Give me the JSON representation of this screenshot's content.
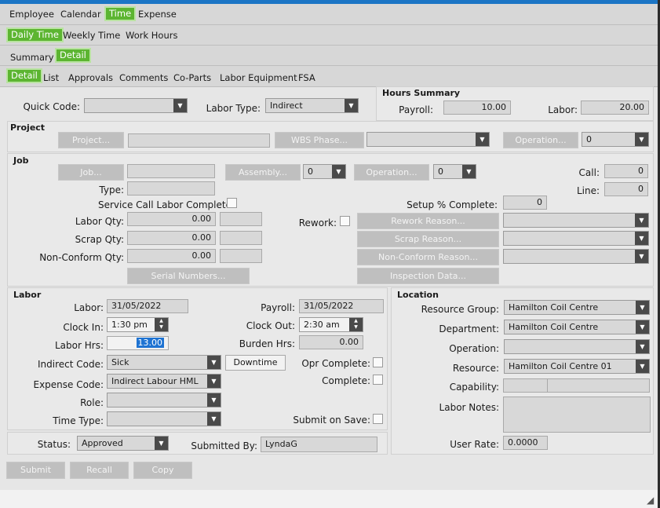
{
  "tabs1": [
    "Employee",
    "Calendar",
    "Time",
    "Expense"
  ],
  "tabs2": [
    "Daily Time",
    "Weekly Time",
    "Work Hours"
  ],
  "tabs3": [
    "Summary",
    "Detail"
  ],
  "tabs4": [
    "Detail",
    "List",
    "Approvals",
    "Comments",
    "Co-Parts",
    "Labor Equipment",
    "FSA"
  ],
  "header": {
    "quick_code_label": "Quick Code:",
    "quick_code": "",
    "labor_type_label": "Labor Type:",
    "labor_type": "Indirect"
  },
  "hours_summary": {
    "title": "Hours Summary",
    "payroll_label": "Payroll:",
    "payroll": "10.00",
    "labor_label": "Labor:",
    "labor": "20.00"
  },
  "project": {
    "title": "Project",
    "project_btn": "Project...",
    "wbs_btn": "WBS Phase...",
    "operation_btn": "Operation...",
    "operation_value": "0"
  },
  "job": {
    "title": "Job",
    "job_btn": "Job...",
    "assembly_btn": "Assembly...",
    "assembly_value": "0",
    "operation_btn": "Operation...",
    "operation_value": "0",
    "call_label": "Call:",
    "call": "0",
    "line_label": "Line:",
    "line": "0",
    "type_label": "Type:",
    "service_call_label": "Service Call Labor Complete",
    "setup_label": "Setup % Complete:",
    "setup": "0",
    "labor_qty_label": "Labor Qty:",
    "labor_qty": "0.00",
    "scrap_qty_label": "Scrap Qty:",
    "scrap_qty": "0.00",
    "nonconform_qty_label": "Non-Conform Qty:",
    "nonconform_qty": "0.00",
    "rework_label": "Rework:",
    "rework_reason_btn": "Rework Reason...",
    "scrap_reason_btn": "Scrap Reason...",
    "nonconform_reason_btn": "Non-Conform Reason...",
    "serial_btn": "Serial Numbers...",
    "inspection_btn": "Inspection Data..."
  },
  "labor": {
    "title": "Labor",
    "labor_label": "Labor:",
    "labor_date": "31/05/2022",
    "payroll_label": "Payroll:",
    "payroll_date": "31/05/2022",
    "clock_in_label": "Clock In:",
    "clock_in": "1:30 pm",
    "clock_out_label": "Clock Out:",
    "clock_out": "2:30 am",
    "labor_hrs_label": "Labor Hrs:",
    "labor_hrs": "13.00",
    "burden_hrs_label": "Burden Hrs:",
    "burden_hrs": "0.00",
    "indirect_code_label": "Indirect Code:",
    "indirect_code": "Sick",
    "downtime_btn": "Downtime",
    "opr_complete_label": "Opr Complete:",
    "complete_label": "Complete:",
    "expense_code_label": "Expense Code:",
    "expense_code": "Indirect Labour HML",
    "role_label": "Role:",
    "time_type_label": "Time Type:",
    "submit_on_save_label": "Submit on Save:"
  },
  "status": {
    "status_label": "Status:",
    "status": "Approved",
    "submitted_by_label": "Submitted By:",
    "submitted_by": "LyndaG"
  },
  "location": {
    "title": "Location",
    "resource_group_label": "Resource Group:",
    "resource_group": "Hamilton Coil Centre",
    "department_label": "Department:",
    "department": "Hamilton Coil Centre",
    "operation_label": "Operation:",
    "resource_label": "Resource:",
    "resource": "Hamilton Coil Centre 01",
    "capability_label": "Capability:",
    "labor_notes_label": "Labor Notes:",
    "user_rate_label": "User Rate:",
    "user_rate": "0.0000"
  },
  "footer": {
    "submit": "Submit",
    "recall": "Recall",
    "copy": "Copy"
  },
  "colors": {
    "accent": "#5cb531",
    "title_bar": "#1b75c5"
  }
}
